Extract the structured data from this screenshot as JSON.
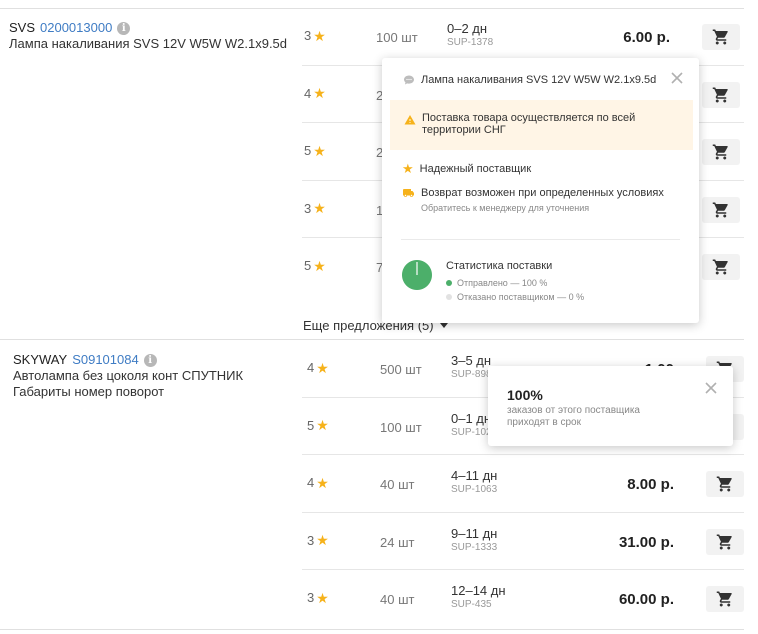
{
  "icons": {
    "star": "star-icon",
    "cart": "cart-icon",
    "info": "info-icon",
    "close": "close-icon",
    "chat": "chat-icon",
    "warning": "warning-icon",
    "truck": "truck-icon",
    "caret": "caret-down-icon"
  },
  "colors": {
    "star": "#f6b21b",
    "link": "#3f7cc4",
    "success": "#4caf6a",
    "warning_bg": "#fff5e6",
    "warning_icon": "#f6b21b"
  },
  "products": [
    {
      "brand": "SVS",
      "code": "0200013000",
      "name": "Лампа накаливания SVS 12V W5W W2.1x9.5d",
      "offers": [
        {
          "rating": "3",
          "qty": "100 шт",
          "days": "0–2 дн",
          "sup": "SUP-1378",
          "price": "6.00 р."
        },
        {
          "rating": "4",
          "qty": "2",
          "days": "",
          "sup": "",
          "price": ""
        },
        {
          "rating": "5",
          "qty": "2",
          "days": "",
          "sup": "",
          "price": ""
        },
        {
          "rating": "3",
          "qty": "1",
          "days": "",
          "sup": "",
          "price": ""
        },
        {
          "rating": "5",
          "qty": "7",
          "days": "",
          "sup": "",
          "price": ""
        }
      ],
      "more_offers": "Еще предложения (5)"
    },
    {
      "brand": "SKYWAY",
      "code": "S09101084",
      "name": "Автолампа без цоколя конт СПУТНИК Габариты номер поворот",
      "offers": [
        {
          "rating": "4",
          "qty": "500 шт",
          "days": "3–5 дн",
          "sup": "SUP-898",
          "price": "1.00"
        },
        {
          "rating": "5",
          "qty": "100 шт",
          "days": "0–1 дн",
          "sup": "SUP-102",
          "price": ""
        },
        {
          "rating": "4",
          "qty": "40 шт",
          "days": "4–11 дн",
          "sup": "SUP-1063",
          "price": "8.00 р."
        },
        {
          "rating": "3",
          "qty": "24 шт",
          "days": "9–11 дн",
          "sup": "SUP-1333",
          "price": "31.00 р."
        },
        {
          "rating": "3",
          "qty": "40 шт",
          "days": "12–14 дн",
          "sup": "SUP-435",
          "price": "60.00 р."
        }
      ]
    }
  ],
  "popup_main": {
    "title": "Лампа накаливания SVS 12V W5W W2.1x9.5d",
    "warning": "Поставка товара осуществляется по всей территории СНГ",
    "reliable": "Надежный поставщик",
    "return": "Возврат возможен при определенных условиях",
    "return_sub": "Обратитесь к менеджеру для уточнения",
    "stats_title": "Статистика поставки",
    "sent": "Отправлено — 100 %",
    "refused": "Отказано поставщиком — 0 %",
    "sent_fraction": 1.0
  },
  "popup_small": {
    "value": "100%",
    "text": "заказов от этого поставщика приходят в срок"
  }
}
